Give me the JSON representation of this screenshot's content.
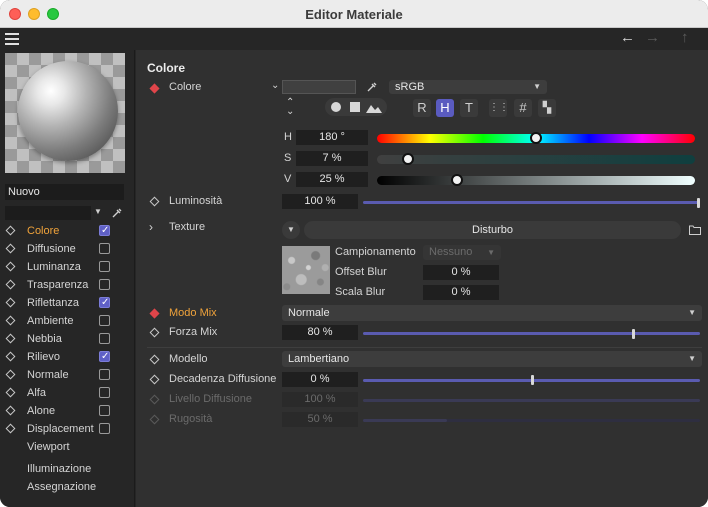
{
  "window": {
    "title": "Editor Materiale"
  },
  "toolbar": {
    "icons": [
      "hamburger-menu-icon",
      "arrow-left-icon",
      "arrow-right-icon",
      "arrow-up-icon"
    ],
    "back": "←",
    "forward": "→",
    "up": "↑"
  },
  "sidebar": {
    "material_name": "Nuovo",
    "channels": [
      {
        "label": "Colore",
        "active": true,
        "checked": true
      },
      {
        "label": "Diffusione",
        "active": false,
        "checked": false
      },
      {
        "label": "Luminanza",
        "active": false,
        "checked": false
      },
      {
        "label": "Trasparenza",
        "active": false,
        "checked": false
      },
      {
        "label": "Riflettanza",
        "active": false,
        "checked": true
      },
      {
        "label": "Ambiente",
        "active": false,
        "checked": false
      },
      {
        "label": "Nebbia",
        "active": false,
        "checked": false
      },
      {
        "label": "Rilievo",
        "active": false,
        "checked": true
      },
      {
        "label": "Normale",
        "active": false,
        "checked": false
      },
      {
        "label": "Alfa",
        "active": false,
        "checked": false
      },
      {
        "label": "Alone",
        "active": false,
        "checked": false
      },
      {
        "label": "Displacement",
        "active": false,
        "checked": false
      },
      {
        "label": "Viewport"
      }
    ],
    "links": [
      "Illuminazione",
      "Assegnazione"
    ]
  },
  "main": {
    "section_title": "Colore",
    "colore": {
      "label": "Colore",
      "swatch_color": "#404040",
      "color_space": "sRGB",
      "mode_icons": [
        "color-wheel-icon",
        "spectrum-icon",
        "image-icon"
      ],
      "mode_buttons": [
        "R",
        "H",
        "T",
        "⋮⋮",
        "#",
        "▚"
      ],
      "active_mode": "H",
      "h_label": "H",
      "h_value": "180 °",
      "h_fraction": 0.5,
      "s_label": "S",
      "s_value": "7 %",
      "s_fraction": 0.07,
      "v_label": "V",
      "v_value": "25 %",
      "v_fraction": 0.25
    },
    "luminosita": {
      "label": "Luminosità",
      "value": "100 %",
      "fraction": 1.0
    },
    "texture": {
      "label": "Texture",
      "shader": "Disturbo",
      "campionamento_label": "Campionamento",
      "campionamento_value": "Nessuno",
      "offset_label": "Offset Blur",
      "offset_value": "0 %",
      "scala_label": "Scala Blur",
      "scala_value": "0 %"
    },
    "modo_mix": {
      "label": "Modo Mix",
      "value": "Normale"
    },
    "forza_mix": {
      "label": "Forza Mix",
      "value": "80 %",
      "fraction": 0.8
    },
    "modello": {
      "label": "Modello",
      "value": "Lambertiano"
    },
    "decadenza": {
      "label": "Decadenza Diffusione",
      "value": "0 %",
      "fraction": 0.5
    },
    "livello": {
      "label": "Livello Diffusione",
      "value": "100 %",
      "fraction": 1.0
    },
    "rugosita": {
      "label": "Rugosità",
      "value": "50 %",
      "fraction": 0.25
    }
  },
  "colors": {
    "accent": "#5a5bc0",
    "active_label": "#f0a33b",
    "keyframe_red": "#e0454a"
  }
}
